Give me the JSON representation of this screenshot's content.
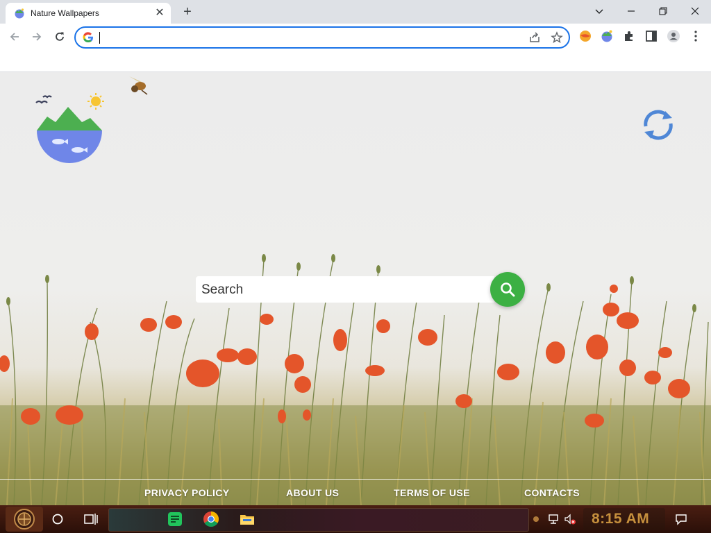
{
  "browser": {
    "tab_title": "Nature Wallpapers",
    "tab_close_glyph": "✕",
    "new_tab_glyph": "+",
    "address_value": "",
    "accent_color": "#1a73e8"
  },
  "page": {
    "search_placeholder": "Search",
    "search_button_color": "#3cb043",
    "footer_links": [
      {
        "label": "PRIVACY POLICY"
      },
      {
        "label": "ABOUT US"
      },
      {
        "label": "TERMS OF USE"
      },
      {
        "label": "CONTACTS"
      }
    ]
  },
  "taskbar": {
    "clock": "8:15 AM",
    "clock_color": "#c6903d"
  }
}
